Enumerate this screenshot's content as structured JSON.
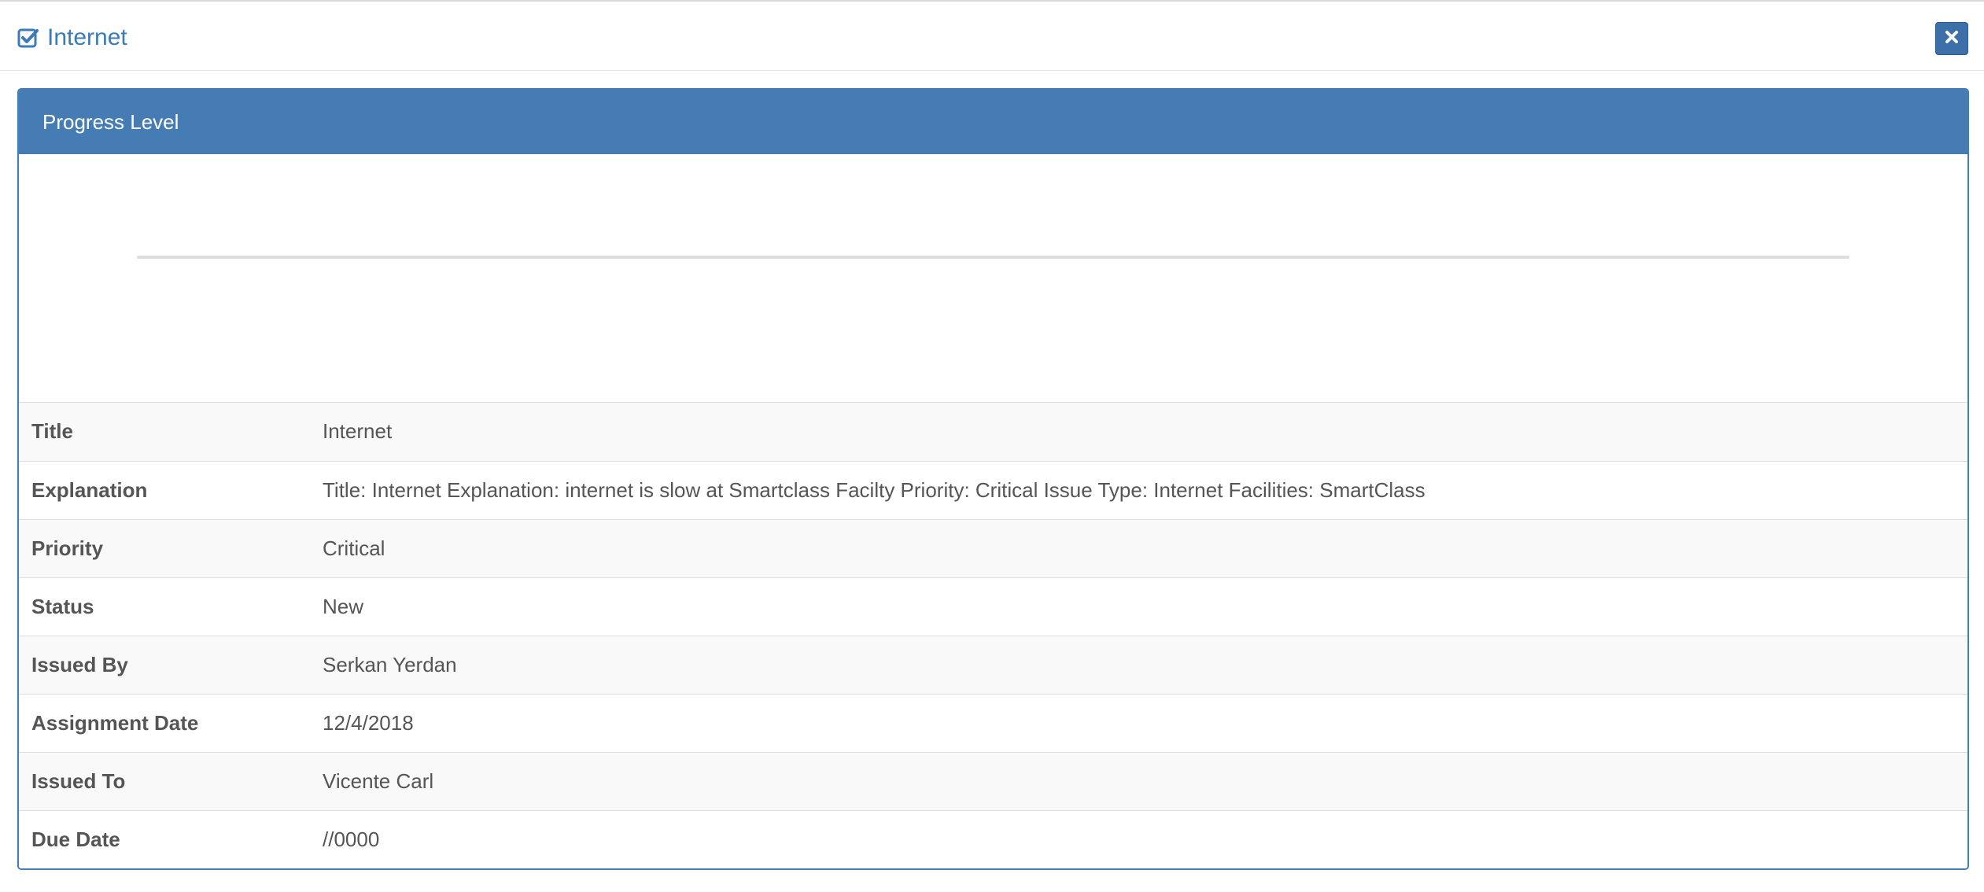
{
  "modal": {
    "title": "Internet",
    "title_icon": "check-square-icon",
    "close_icon": "close-icon",
    "accent_color": "#457cb3"
  },
  "panel": {
    "heading": "Progress Level",
    "progress_fraction": 0
  },
  "details": [
    {
      "label": "Title",
      "value": "Internet"
    },
    {
      "label": "Explanation",
      "value": "Title: Internet Explanation: internet is slow at Smartclass Facilty Priority: Critical Issue Type: Internet Facilities: SmartClass"
    },
    {
      "label": "Priority",
      "value": "Critical"
    },
    {
      "label": "Status",
      "value": "New"
    },
    {
      "label": "Issued By",
      "value": "Serkan Yerdan"
    },
    {
      "label": "Assignment Date",
      "value": "12/4/2018"
    },
    {
      "label": "Issued To",
      "value": "Vicente Carl"
    },
    {
      "label": "Due Date",
      "value": "//0000"
    }
  ]
}
